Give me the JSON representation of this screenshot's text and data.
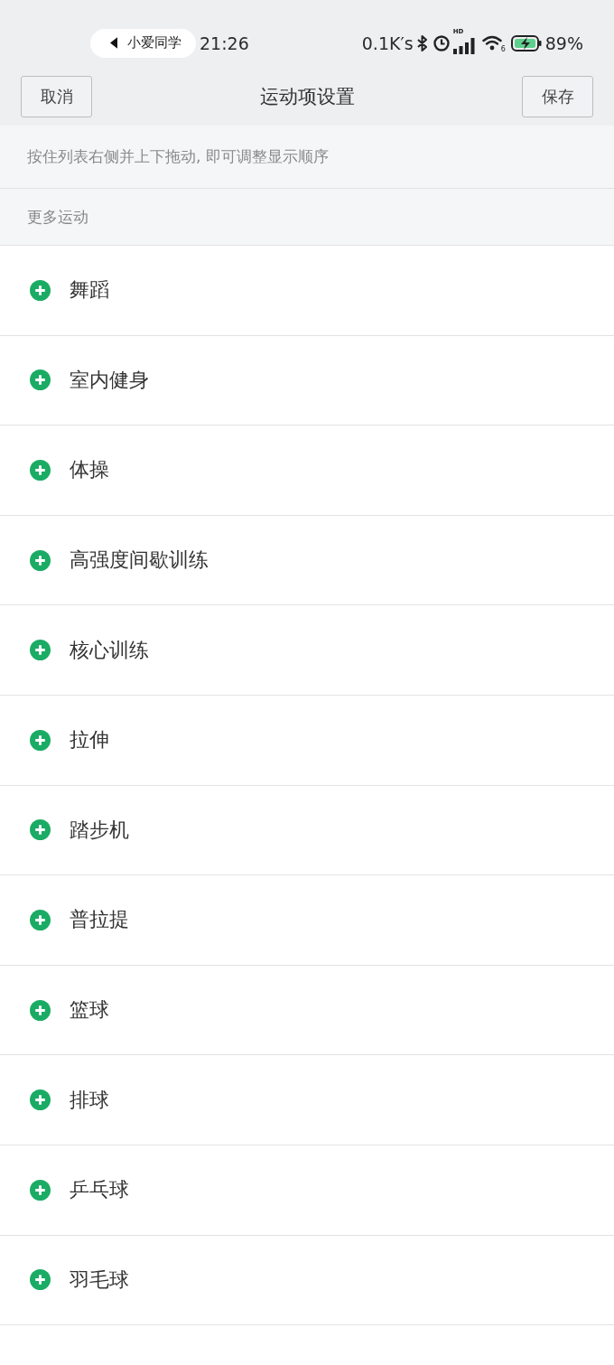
{
  "status_bar": {
    "assistant": "小爱同学",
    "time": "21:26",
    "net_speed": "0.1K′s",
    "signal_label": "HD",
    "wifi_label": "6",
    "battery": "89%"
  },
  "nav_bar": {
    "cancel": "取消",
    "title": "运动项设置",
    "save": "保存"
  },
  "hint": "按住列表右侧并上下拖动, 即可调整显示顺序",
  "section": {
    "title": "更多运动",
    "items": [
      {
        "label": "舞蹈"
      },
      {
        "label": "室内健身"
      },
      {
        "label": "体操"
      },
      {
        "label": "高强度间歇训练"
      },
      {
        "label": "核心训练"
      },
      {
        "label": "拉伸"
      },
      {
        "label": "踏步机"
      },
      {
        "label": "普拉提"
      },
      {
        "label": "篮球"
      },
      {
        "label": "排球"
      },
      {
        "label": "乒乓球"
      },
      {
        "label": "羽毛球"
      }
    ]
  }
}
